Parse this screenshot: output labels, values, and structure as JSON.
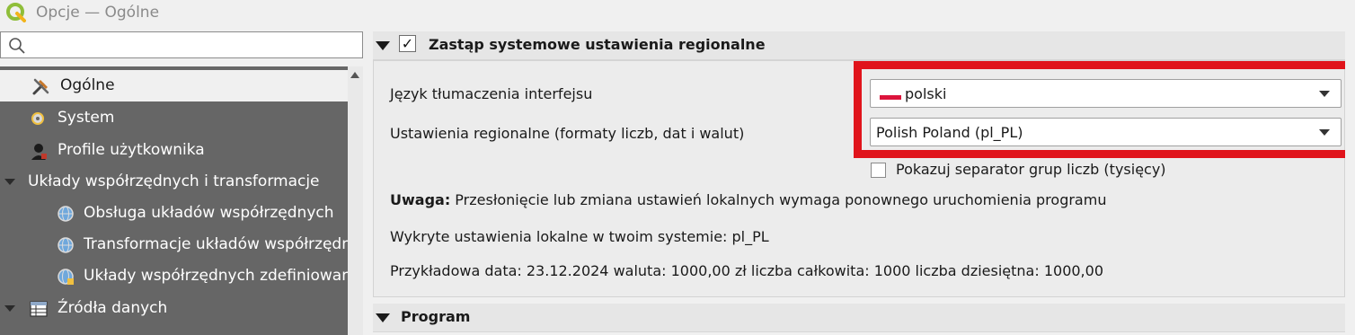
{
  "window": {
    "title": "Opcje — Ogólne"
  },
  "search": {
    "placeholder": ""
  },
  "sidebar": {
    "items": [
      {
        "label": "Ogólne",
        "icon": "tools-icon"
      },
      {
        "label": "System",
        "icon": "system-gear-icon"
      },
      {
        "label": "Profile użytkownika",
        "icon": "user-profile-icon"
      },
      {
        "label": "Układy współrzędnych i transformacje",
        "icon": "",
        "expanded": true
      },
      {
        "label": "Obsługa układów współrzędnych",
        "icon": "globe-icon"
      },
      {
        "label": "Transformacje układów współrzędnych",
        "icon": "globe-transform-icon"
      },
      {
        "label": "Układy współrzędnych zdefiniowane",
        "icon": "globe-user-icon"
      },
      {
        "label": "Źródła danych",
        "icon": "table-icon",
        "expanded": true
      }
    ]
  },
  "locale_group": {
    "title": "Zastąp systemowe ustawienia regionalne",
    "checked": true,
    "language_label": "Język tłumaczenia interfejsu",
    "language_value": "polski",
    "region_label": "Ustawienia regionalne (formaty liczb, dat i walut)",
    "region_value": "Polish Poland (pl_PL)",
    "separator_label": "Pokazuj separator grup liczb (tysięcy)",
    "separator_checked": false,
    "note_bold": "Uwaga:",
    "note_text": " Przesłonięcie lub zmiana ustawień lokalnych wymaga ponownego uruchomienia programu",
    "detected_text": "Wykryte ustawienia lokalne w twoim systemie: pl_PL",
    "sample_text": "Przykładowa data: 23.12.2024 waluta: 1000,00 zł liczba całkowita: 1000 liczba dziesiętna: 1000,00"
  },
  "program_group": {
    "title": "Program"
  },
  "colors": {
    "highlight": "#e0141b",
    "sidebar_bg": "#666666",
    "flag_red": "#dc143c"
  }
}
